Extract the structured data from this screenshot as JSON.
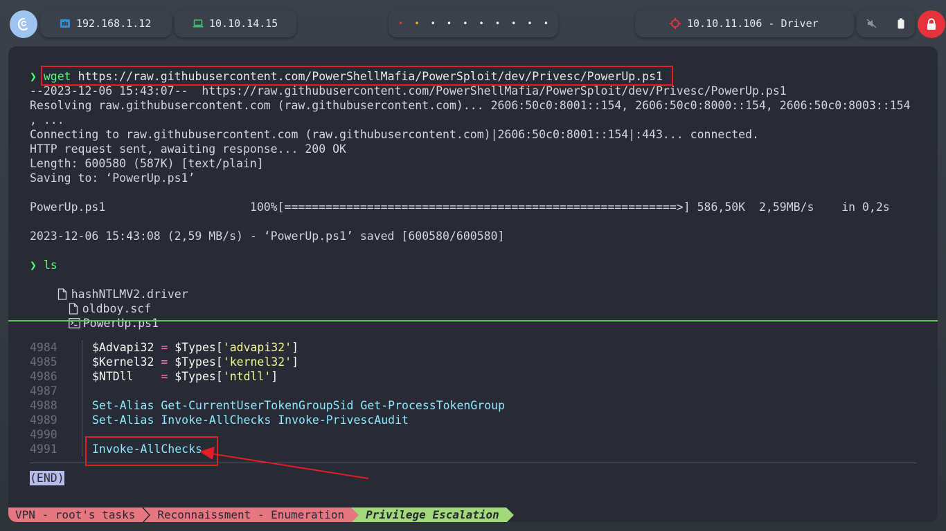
{
  "topbar": {
    "local_ip": "192.168.1.12",
    "vpn_ip": "10.10.14.15",
    "target": "10.10.11.106 - Driver",
    "workspace_dot_colors": [
      "#e5323b",
      "#f0b429",
      "#ffffff",
      "#ffffff",
      "#ffffff",
      "#ffffff",
      "#ffffff",
      "#ffffff",
      "#ffffff",
      "#ffffff"
    ],
    "workspace_dot_glyph": "•",
    "icons": {
      "launcher": "debian-swirl-icon",
      "local_ip": "network-icon",
      "vpn_ip": "laptop-icon",
      "target": "crosshair-icon",
      "sound": "speaker-muted-icon",
      "battery": "battery-icon",
      "power": "lock-icon"
    }
  },
  "terminal": {
    "prompt_symbol": "❯",
    "cmd1": {
      "name": "wget",
      "arg": "https://raw.githubusercontent.com/PowerShellMafia/PowerSploit/dev/Privesc/PowerUp.ps1"
    },
    "output": [
      "--2023-12-06 15:43:07--  https://raw.githubusercontent.com/PowerShellMafia/PowerSploit/dev/Privesc/PowerUp.ps1",
      "Resolving raw.githubusercontent.com (raw.githubusercontent.com)... 2606:50c0:8001::154, 2606:50c0:8000::154, 2606:50c0:8003::154",
      ", ...",
      "Connecting to raw.githubusercontent.com (raw.githubusercontent.com)|2606:50c0:8001::154|:443... connected.",
      "HTTP request sent, awaiting response... 200 OK",
      "Length: 600580 (587K) [text/plain]",
      "Saving to: ‘PowerUp.ps1’",
      "PowerUp.ps1                     100%[=========================================================>] 586,50K  2,59MB/s    in 0,2s",
      "2023-12-06 15:43:08 (2,59 MB/s) - ‘PowerUp.ps1’ saved [600580/600580]"
    ],
    "cmd2": "ls",
    "files": [
      {
        "icon": "file-icon",
        "name": "hashNTLMV2.driver"
      },
      {
        "icon": "file-icon",
        "name": "oldboy.scf"
      },
      {
        "icon": "terminal-file-icon",
        "name": "PowerUp.ps1"
      }
    ]
  },
  "editor": {
    "line_numbers": [
      "4984",
      "4985",
      "4986",
      "4987",
      "4988",
      "4989",
      "4990",
      "4991"
    ],
    "code": {
      "l1_var": "$Advapi32",
      "l1_eq": " = ",
      "l1_mid": "$Types[",
      "l1_str": "'advapi32'",
      "l1_end": "]",
      "l2_var": "$Kernel32",
      "l2_eq": " = ",
      "l2_mid": "$Types[",
      "l2_str": "'kernel32'",
      "l2_end": "]",
      "l3_var": "$NTDll    ",
      "l3_eq": "= ",
      "l3_mid": "$Types[",
      "l3_str": "'ntdll'",
      "l3_end": "]",
      "l5": "Set-Alias Get-CurrentUserTokenGroupSid Get-ProcessTokenGroup",
      "l6": "Set-Alias Invoke-AllChecks Invoke-PrivescAudit",
      "l8": "Invoke-AllChecks"
    },
    "end_marker": "(END)"
  },
  "statusline": {
    "segments": [
      "VPN - root's tasks",
      "Reconnaissment - Enumeration",
      "Privilege Escalation"
    ]
  },
  "colors": {
    "terminal_bg": "#282a36",
    "prompt_green": "#50fa7b",
    "annotation_red": "#e21d24",
    "status_pink": "#e87681",
    "status_green": "#a3d97b"
  }
}
